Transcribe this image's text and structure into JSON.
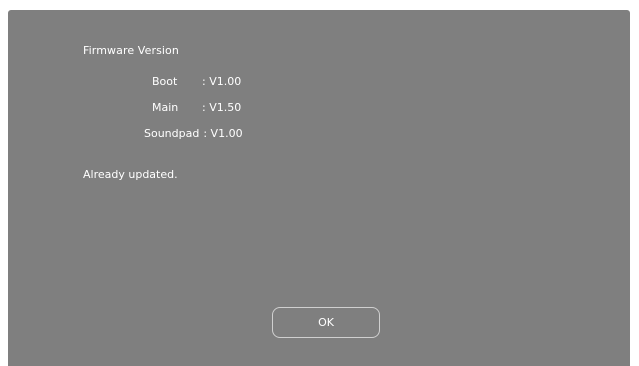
{
  "dialog": {
    "title": "Firmware Version",
    "versions": [
      {
        "name": "Boot",
        "value": ": V1.00"
      },
      {
        "name": "Main",
        "value": ": V1.50"
      },
      {
        "name": "Soundpad",
        "value": ": V1.00"
      }
    ],
    "status": "Already updated.",
    "ok_label": "OK"
  },
  "colors": {
    "dialog_bg": "#7f7f7f",
    "text": "#ffffff",
    "button_border": "#d0d0d0"
  }
}
